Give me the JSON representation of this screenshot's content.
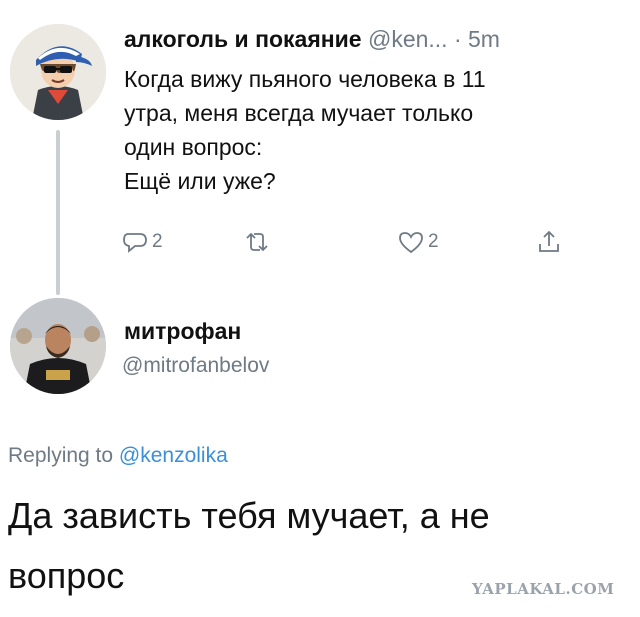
{
  "tweet1": {
    "author_name": "алкоголь и покаяние",
    "handle": "@ken...",
    "time": "· 5m",
    "text_lines": [
      "Когда вижу пьяного человека в 11",
      "утра, меня всегда мучает только",
      "один вопрос:",
      "Ещё или уже?"
    ],
    "reply_count": "2",
    "like_count": "2",
    "icons": [
      "reply-icon",
      "retweet-icon",
      "like-icon",
      "share-icon"
    ]
  },
  "tweet2": {
    "author_name": "митрофан",
    "handle": "@mitrofanbelov",
    "replying_prefix": "Replying to",
    "replying_to": "@kenzolika",
    "text_lines": [
      "Да зависть тебя мучает, а не",
      "вопрос"
    ]
  },
  "watermark": "YAPLAKAL.COM",
  "colors": {
    "muted": "#6e7a85",
    "link": "#3a8fd8",
    "thread_line": "#c9ced3"
  }
}
